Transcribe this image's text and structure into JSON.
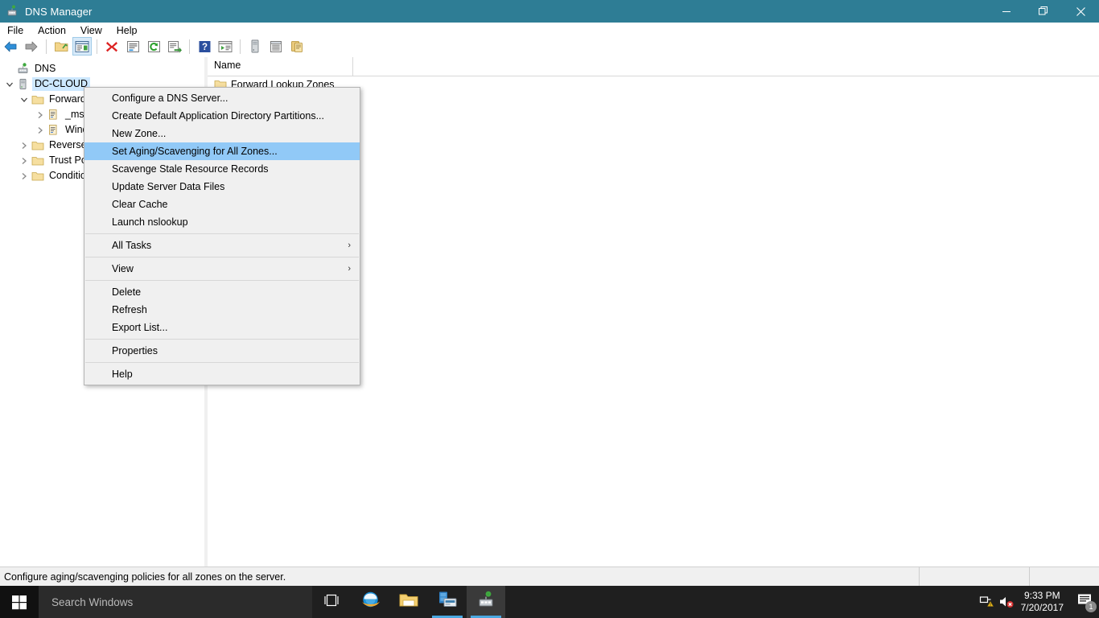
{
  "window": {
    "title": "DNS Manager",
    "icon": "dns-manager-icon",
    "buttons": {
      "minimize": "minimize-icon",
      "restore": "restore-icon",
      "close": "close-icon"
    }
  },
  "menubar": {
    "items": [
      {
        "label": "File",
        "name": "menu-file"
      },
      {
        "label": "Action",
        "name": "menu-action"
      },
      {
        "label": "View",
        "name": "menu-view"
      },
      {
        "label": "Help",
        "name": "menu-help"
      }
    ]
  },
  "toolbar": {
    "items": [
      {
        "icon": "back-arrow-icon",
        "pressed": false
      },
      {
        "icon": "forward-arrow-icon",
        "pressed": false
      },
      {
        "sep": true
      },
      {
        "icon": "up-one-level-folder-icon",
        "pressed": false
      },
      {
        "icon": "show-hide-console-tree-icon",
        "pressed": true
      },
      {
        "sep": true
      },
      {
        "icon": "delete-icon",
        "pressed": false
      },
      {
        "icon": "properties-icon",
        "pressed": false
      },
      {
        "icon": "refresh-icon",
        "pressed": false
      },
      {
        "icon": "export-list-icon",
        "pressed": false
      },
      {
        "sep": true
      },
      {
        "icon": "help-icon",
        "pressed": false
      },
      {
        "icon": "show-hide-action-pane-icon",
        "pressed": false
      },
      {
        "sep": true
      },
      {
        "icon": "new-server-icon",
        "pressed": false
      },
      {
        "icon": "list-view-icon",
        "pressed": false
      },
      {
        "icon": "copy-icon",
        "pressed": false
      }
    ]
  },
  "tree": {
    "nodes": [
      {
        "label": "DNS",
        "icon": "dns-root-icon",
        "indent": 0,
        "twisty": "",
        "selected": false
      },
      {
        "label": "DC-CLOUD",
        "icon": "server-icon",
        "indent": 1,
        "twisty": "open",
        "selected": true
      },
      {
        "label": "Forward Lookup Zones",
        "icon": "folder-icon",
        "indent": 2,
        "twisty": "open",
        "selected": false
      },
      {
        "label": "_msdcs.cloud.local",
        "icon": "zone-icon",
        "indent": 3,
        "twisty": "closed",
        "selected": false
      },
      {
        "label": "Windows.cloud.local",
        "icon": "zone-icon",
        "indent": 3,
        "twisty": "closed",
        "selected": false
      },
      {
        "label": "Reverse Lookup Zones",
        "icon": "folder-icon",
        "indent": 2,
        "twisty": "closed",
        "selected": false
      },
      {
        "label": "Trust Points",
        "icon": "folder-icon",
        "indent": 2,
        "twisty": "closed",
        "selected": false
      },
      {
        "label": "Conditional Forwarders",
        "icon": "folder-icon",
        "indent": 2,
        "twisty": "closed",
        "selected": false
      }
    ]
  },
  "listview": {
    "columns": [
      {
        "label": "Name",
        "width": 180
      }
    ],
    "rows": [
      {
        "name": "Forward Lookup Zones",
        "icon": "folder-icon"
      }
    ]
  },
  "contextmenu": {
    "items": [
      {
        "label": "Configure a DNS Server...",
        "name": "ctx-configure-dns-server",
        "highlight": false,
        "submenu": false
      },
      {
        "label": "Create Default Application Directory Partitions...",
        "name": "ctx-create-default-app-dir-partitions",
        "highlight": false,
        "submenu": false
      },
      {
        "label": "New Zone...",
        "name": "ctx-new-zone",
        "highlight": false,
        "submenu": false
      },
      {
        "label": "Set Aging/Scavenging for All Zones...",
        "name": "ctx-set-aging-scavenging",
        "highlight": true,
        "submenu": false
      },
      {
        "label": "Scavenge Stale Resource Records",
        "name": "ctx-scavenge-stale-records",
        "highlight": false,
        "submenu": false
      },
      {
        "label": "Update Server Data Files",
        "name": "ctx-update-server-data-files",
        "highlight": false,
        "submenu": false
      },
      {
        "label": "Clear Cache",
        "name": "ctx-clear-cache",
        "highlight": false,
        "submenu": false
      },
      {
        "label": "Launch nslookup",
        "name": "ctx-launch-nslookup",
        "highlight": false,
        "submenu": false
      },
      {
        "sep": true
      },
      {
        "label": "All Tasks",
        "name": "ctx-all-tasks",
        "highlight": false,
        "submenu": true
      },
      {
        "sep": true
      },
      {
        "label": "View",
        "name": "ctx-view",
        "highlight": false,
        "submenu": true
      },
      {
        "sep": true
      },
      {
        "label": "Delete",
        "name": "ctx-delete",
        "highlight": false,
        "submenu": false
      },
      {
        "label": "Refresh",
        "name": "ctx-refresh",
        "highlight": false,
        "submenu": false
      },
      {
        "label": "Export List...",
        "name": "ctx-export-list",
        "highlight": false,
        "submenu": false
      },
      {
        "sep": true
      },
      {
        "label": "Properties",
        "name": "ctx-properties",
        "highlight": false,
        "submenu": false
      },
      {
        "sep": true
      },
      {
        "label": "Help",
        "name": "ctx-help",
        "highlight": false,
        "submenu": false
      }
    ],
    "submenu_arrow": "›"
  },
  "statusbar": {
    "text": "Configure aging/scavenging policies for all zones on the server."
  },
  "taskbar": {
    "start": "windows-start-icon",
    "search_placeholder": "Search Windows",
    "tasks": [
      {
        "name": "task-view-button",
        "icon": "task-view-icon",
        "active": false,
        "running": false
      },
      {
        "name": "internet-explorer-button",
        "icon": "internet-explorer-icon",
        "active": false,
        "running": false
      },
      {
        "name": "file-explorer-button",
        "icon": "file-explorer-icon",
        "active": false,
        "running": false
      },
      {
        "name": "server-manager-button",
        "icon": "server-manager-icon",
        "active": false,
        "running": true
      },
      {
        "name": "dns-manager-button",
        "icon": "dns-manager-icon",
        "active": true,
        "running": true
      }
    ],
    "tray": {
      "network": "network-warning-icon",
      "volume": "volume-muted-icon",
      "time": "9:33 PM",
      "date": "7/20/2017",
      "action_center": "action-center-icon",
      "notification_count": "1"
    }
  },
  "colors": {
    "titlebar": "#2e7d95",
    "menu_highlight": "#91c9f7",
    "tree_selection": "#cde8ff",
    "taskbar": "#1f1f1f",
    "accent": "#4aa8e0"
  }
}
